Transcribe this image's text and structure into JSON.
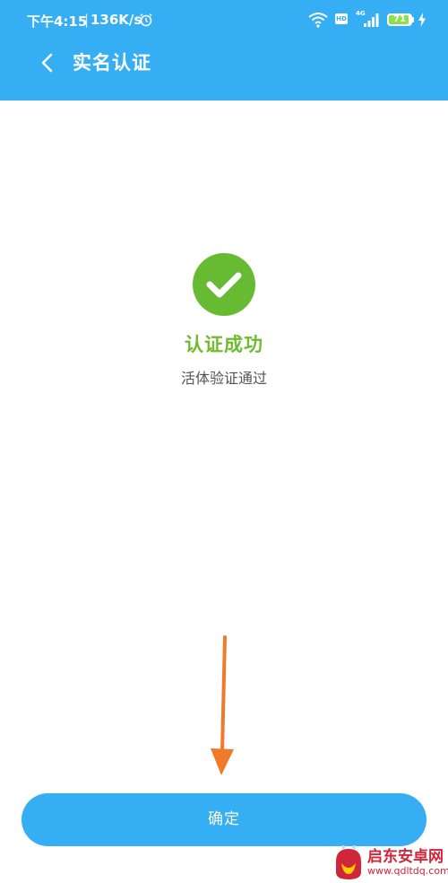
{
  "status_bar": {
    "time": "下午4:15",
    "separator": "|",
    "net_speed": "136K/s",
    "network": "4G",
    "hd": "HD",
    "battery": "71",
    "icons": [
      "alarm-icon",
      "wifi-icon",
      "hd-icon",
      "signal-icon",
      "battery-icon",
      "charging-bolt-icon"
    ]
  },
  "header": {
    "back_icon": "chevron-left-icon",
    "title": "实名认证"
  },
  "result": {
    "icon": "check-circle-icon",
    "title": "认证成功",
    "subtitle": "活体验证通过"
  },
  "confirm_button": {
    "label": "确定"
  },
  "watermark": {
    "name": "启东安卓网",
    "url": "www.qdltdq.com"
  },
  "colors": {
    "primary": "#35aef3",
    "success": "#6fbb2e",
    "check_circle": "#67bb33",
    "arrow_annotation": "#f07a2a",
    "watermark": "#d0263a"
  }
}
